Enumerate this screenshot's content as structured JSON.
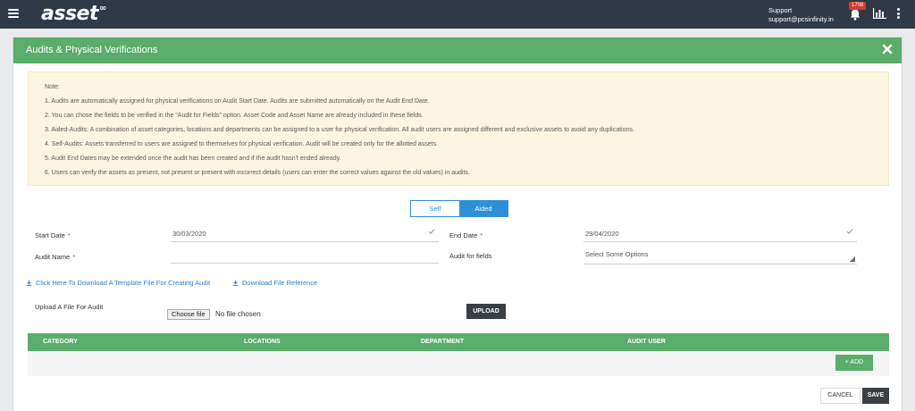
{
  "topbar": {
    "logo": "asset",
    "logo_mark": "∞",
    "support_label": "Support",
    "support_email": "support@pcsinfinity.in",
    "notification_count": "1708"
  },
  "card": {
    "title": "Audits & Physical Verifications"
  },
  "note": {
    "heading": "Note:",
    "items": [
      "1. Audits are automatically assigned for physical verifications on Audit Start Date. Audits are submitted automatically on the Audit End Date.",
      "2. You can chose the fields to be verified in the \"Audit for Fields\" option. Asset Code and Asset Name are already included in these fields.",
      "3. Aided-Audits: A combination of asset categories, locations and departments can be assigned to a user for physical verification. All audit users are assigned different and exclusive assets to avoid any duplications.",
      "4. Self-Audits: Assets transferred to users are assigned to themselves for physical verification. Audit will be created only for the allotted assets.",
      "5. Audit End Dates may be extended once the audit has been created and if the audit hasn't ended already.",
      "6. Users can verify the assets as present, not present or present with incorrect details (users can enter the correct values against the old values) in audits."
    ]
  },
  "toggle": {
    "self": "Self",
    "aided": "Aided",
    "selected": "Aided"
  },
  "form": {
    "start_date_label": "Start Date",
    "start_date_value": "30/03/2020",
    "end_date_label": "End Date",
    "end_date_value": "29/04/2020",
    "audit_name_label": "Audit Name",
    "audit_name_value": "",
    "audit_fields_label": "Audit for fields",
    "audit_fields_placeholder": "Select Some Options",
    "required_mark": "*"
  },
  "links": {
    "template": "Click Here To Download A Template File For Creating Audit",
    "reference": "Download File Reference"
  },
  "upload": {
    "label": "Upload A File For Audit",
    "choose_button": "Choose file",
    "status": "No file chosen",
    "upload_button": "UPLOAD"
  },
  "table": {
    "columns": [
      "CATEGORY",
      "LOCATIONS",
      "DEPARTMENT",
      "AUDIT USER"
    ],
    "add_button": "+ ADD"
  },
  "actions": {
    "cancel": "CANCEL",
    "save": "SAVE"
  },
  "colors": {
    "topbar": "#2f3a46",
    "header_green": "#5aad6a",
    "accent_blue": "#2e8fd9",
    "note_bg": "#fcf5e1",
    "badge_red": "#d63a2f"
  }
}
